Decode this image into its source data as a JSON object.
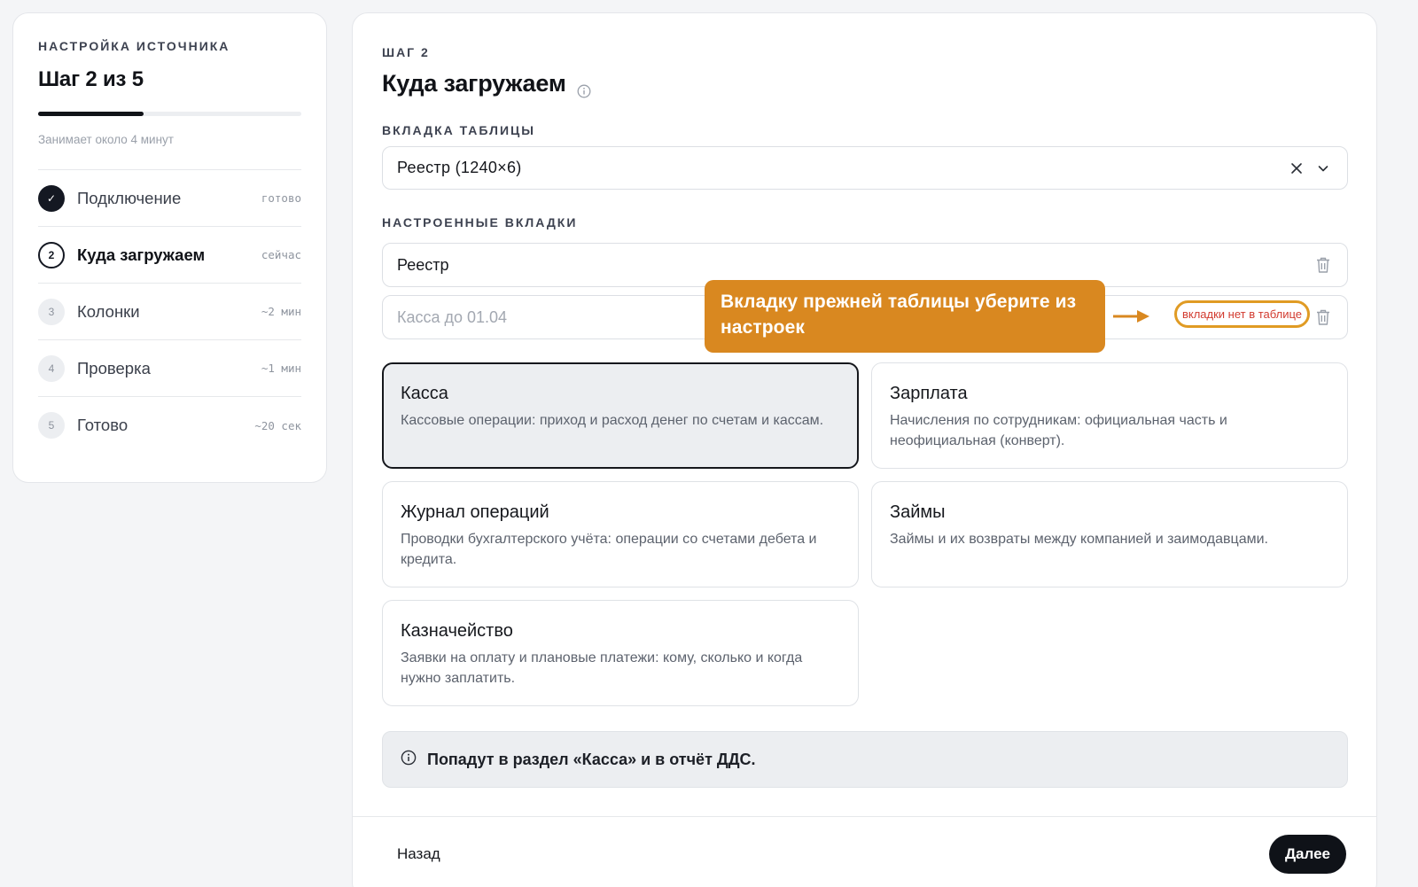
{
  "sidebar": {
    "eyebrow": "НАСТРОЙКА ИСТОЧНИКА",
    "title": "Шаг 2 из 5",
    "progress_fraction": 0.4,
    "duration": "Занимает около 4 минут",
    "steps": [
      {
        "marker": "✓",
        "label": "Подключение",
        "meta": "готово",
        "state": "done"
      },
      {
        "marker": "2",
        "label": "Куда загружаем",
        "meta": "сейчас",
        "state": "current"
      },
      {
        "marker": "3",
        "label": "Колонки",
        "meta": "~2 мин",
        "state": "pending"
      },
      {
        "marker": "4",
        "label": "Проверка",
        "meta": "~1 мин",
        "state": "pending"
      },
      {
        "marker": "5",
        "label": "Готово",
        "meta": "~20 сек",
        "state": "pending"
      }
    ]
  },
  "main": {
    "eyebrow": "ШАГ 2",
    "title": "Куда загружаем",
    "tab_label": "ВКЛАДКА ТАБЛИЦЫ",
    "tab_select_value": "Реестр (1240×6)",
    "configured_label": "НАСТРОЕННЫЕ ВКЛАДКИ",
    "configured_tabs": [
      {
        "name": "Реестр"
      },
      {
        "name": "Касса до 01.04",
        "warning": "вкладки нет в таблице"
      }
    ],
    "callout": "Вкладку прежней таблицы уберите из настроек",
    "cards": [
      {
        "title": "Касса",
        "desc": "Кассовые операции: приход и расход денег по счетам и кассам.",
        "selected": true
      },
      {
        "title": "Зарплата",
        "desc": "Начисления по сотрудникам: официальная часть и неофициальная (конверт)."
      },
      {
        "title": "Журнал операций",
        "desc": "Проводки бухгалтерского учёта: операции со счетами дебета и кредита."
      },
      {
        "title": "Займы",
        "desc": "Займы и их возвраты между компанией и заимодавцами."
      },
      {
        "title": "Казначейство",
        "desc": "Заявки на оплату и плановые платежи: кому, сколько и когда нужно заплатить."
      }
    ],
    "hint": "Попадут в раздел «Касса» и в отчёт ДДС.",
    "back_label": "Назад",
    "next_label": "Далее"
  },
  "colors": {
    "accent_dark": "#0f1218",
    "callout_orange": "#d98820",
    "warning_red": "#d23b2f",
    "warning_outline": "#e09b24"
  },
  "icons": [
    "check-icon",
    "info-icon",
    "close-icon",
    "chevron-down-icon",
    "trash-icon",
    "arrow-right-icon"
  ]
}
